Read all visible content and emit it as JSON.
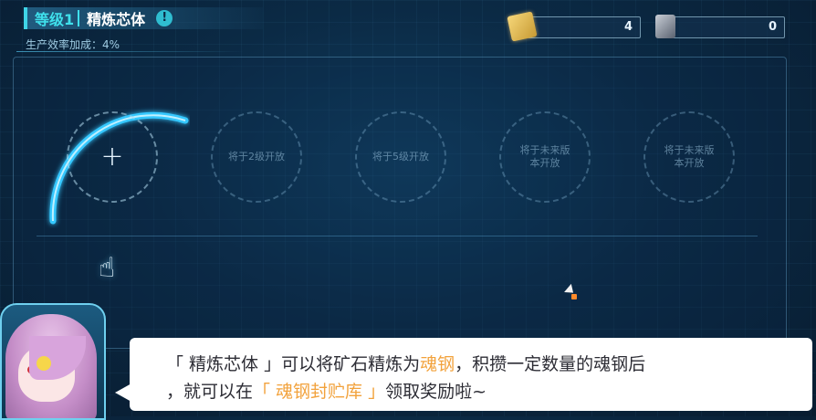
{
  "header": {
    "level_label": "等级1",
    "title": "精炼芯体",
    "info_glyph": "!",
    "bonus_text": "生产效率加成：4%"
  },
  "resources": [
    {
      "icon": "ore-chip-icon",
      "count": "4"
    },
    {
      "icon": "soul-steel-icon",
      "count": "0"
    }
  ],
  "slots": [
    {
      "label": "+",
      "active": true
    },
    {
      "label": "将于2级开放"
    },
    {
      "label": "将于5级开放"
    },
    {
      "label": "将于未来版本开放"
    },
    {
      "label": "将于未来版本开放"
    }
  ],
  "dialog": {
    "line1_a": "「 精炼芯体 」可以将矿石精炼为",
    "line1_hl": "魂钢",
    "line1_b": "，积攒一定数量的魂钢后",
    "line2_a": "，就可以在",
    "line2_hl": "「 魂钢封贮库 」",
    "line2_b": "领取奖励啦~"
  },
  "colors": {
    "accent_cyan": "#3fe0ec",
    "highlight_orange": "#f2a23c",
    "background": "#0b2a45"
  }
}
